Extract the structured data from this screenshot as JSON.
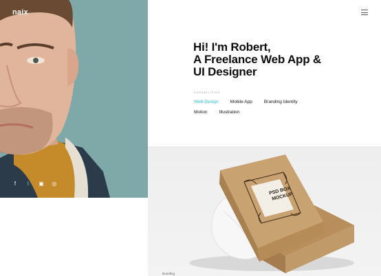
{
  "brand": {
    "logo_text": "naix"
  },
  "header": {
    "menu_icon": "hamburger-icon"
  },
  "intro": {
    "headline": [
      "Hi! I'm Robert,",
      "A Freelance Web App &",
      "UI Designer"
    ],
    "capabilities_label": "CAPABILITIES",
    "capabilities": [
      [
        "Web-Design",
        "Mobile App",
        "Branding Identity"
      ],
      [
        "Motion",
        "Illustration"
      ]
    ],
    "active_capability": "Web-Design"
  },
  "social": [
    {
      "icon": "facebook-icon",
      "glyph": "f"
    },
    {
      "icon": "twitter-icon",
      "glyph": "t"
    },
    {
      "icon": "instagram-icon",
      "glyph": "▣"
    },
    {
      "icon": "dribbble-icon",
      "glyph": "◎"
    }
  ],
  "product": {
    "box_title_line1": "PSD BOX",
    "box_title_line2": "MOCKUP",
    "caption": "Branding"
  },
  "colors": {
    "hero_bg": "#7fa8a8",
    "accent": "#29c5d2",
    "text": "#0c0c0c"
  }
}
